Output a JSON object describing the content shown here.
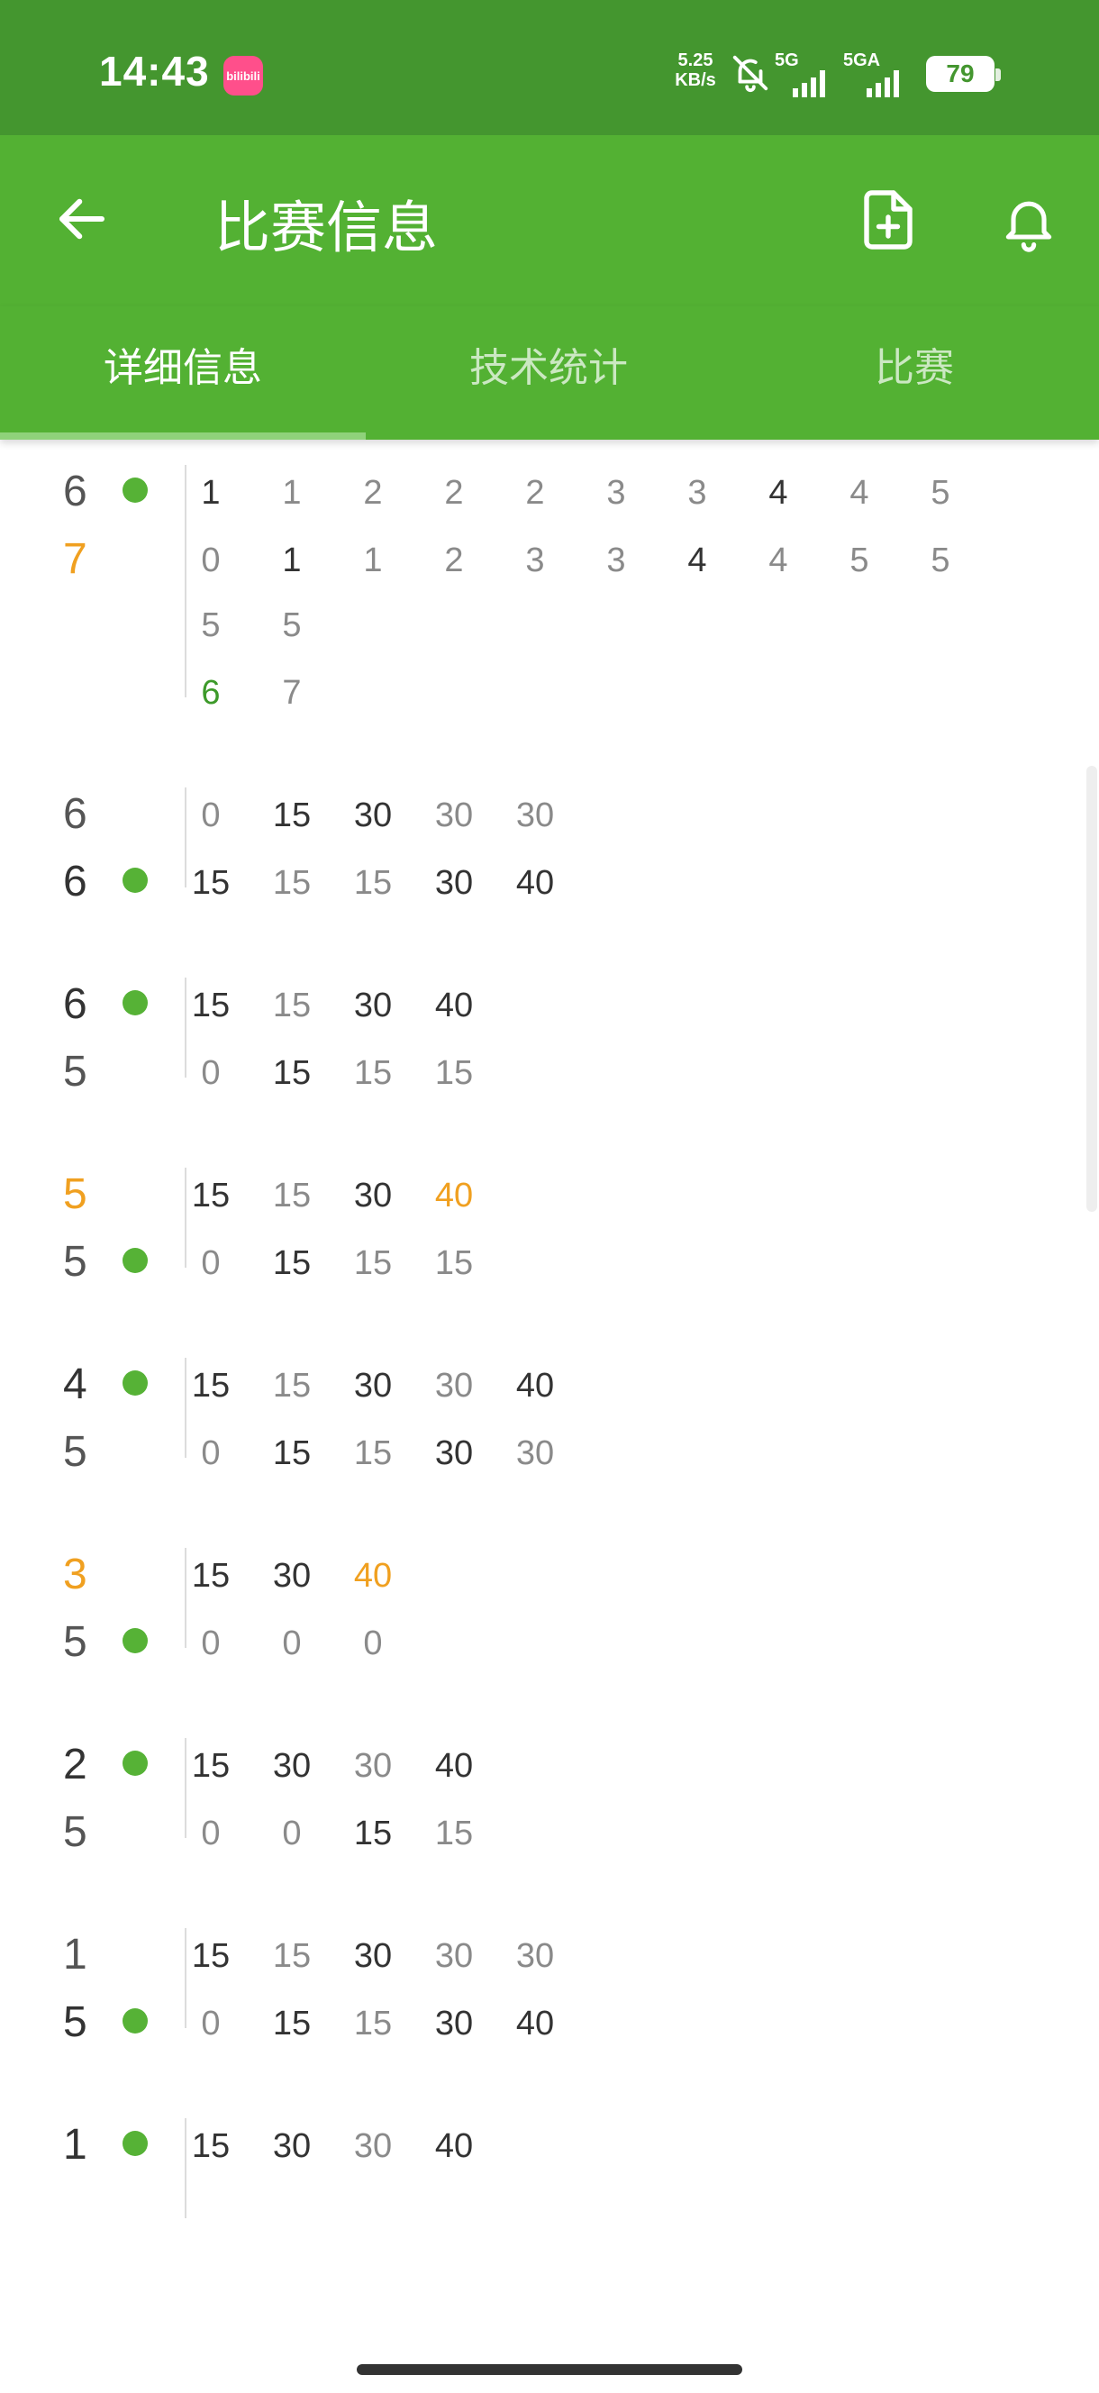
{
  "status_bar": {
    "time": "14:43",
    "app_badge": "bilibili",
    "net_speed_value": "5.25",
    "net_speed_unit": "KB/s",
    "signal1_label": "5G",
    "signal2_label": "5GA",
    "battery": "79"
  },
  "app_bar": {
    "title": "比赛信息"
  },
  "tabs": [
    {
      "label": "详细信息",
      "active": true
    },
    {
      "label": "技术统计",
      "active": false
    },
    {
      "label": "比赛",
      "active": false
    }
  ],
  "colors": {
    "status_bar": "#44962f",
    "primary": "#53b133",
    "serve_dot": "#56b236",
    "highlight": "#f0a020"
  },
  "games": [
    {
      "top_score": "6",
      "bottom_score": "7",
      "top_style": "normal",
      "bottom_style": "win",
      "server": "top",
      "rows": [
        {
          "top": [
            [
              "1",
              "b"
            ],
            [
              "1",
              "n"
            ],
            [
              "2",
              "n"
            ],
            [
              "2",
              "n"
            ],
            [
              "2",
              "n"
            ],
            [
              "3",
              "n"
            ],
            [
              "3",
              "n"
            ],
            [
              "4",
              "b"
            ],
            [
              "4",
              "n"
            ],
            [
              "5",
              "n"
            ]
          ],
          "bottom": [
            [
              "0",
              "n"
            ],
            [
              "1",
              "b"
            ],
            [
              "1",
              "n"
            ],
            [
              "2",
              "n"
            ],
            [
              "3",
              "n"
            ],
            [
              "3",
              "n"
            ],
            [
              "4",
              "b"
            ],
            [
              "4",
              "n"
            ],
            [
              "5",
              "n"
            ],
            [
              "5",
              "n"
            ]
          ]
        },
        {
          "top": [
            [
              "5",
              "n"
            ],
            [
              "5",
              "n"
            ]
          ],
          "bottom": [
            [
              "6",
              "g"
            ],
            [
              "7",
              "n"
            ]
          ]
        }
      ]
    },
    {
      "top_score": "6",
      "bottom_score": "6",
      "top_style": "normal",
      "bottom_style": "dark",
      "server": "bottom",
      "rows": [
        {
          "top": [
            [
              "0",
              "n"
            ],
            [
              "15",
              "b"
            ],
            [
              "30",
              "b"
            ],
            [
              "30",
              "n"
            ],
            [
              "30",
              "n"
            ]
          ],
          "bottom": [
            [
              "15",
              "b"
            ],
            [
              "15",
              "n"
            ],
            [
              "15",
              "n"
            ],
            [
              "30",
              "b"
            ],
            [
              "40",
              "b"
            ]
          ]
        }
      ]
    },
    {
      "top_score": "6",
      "bottom_score": "5",
      "top_style": "dark",
      "bottom_style": "normal",
      "server": "top",
      "rows": [
        {
          "top": [
            [
              "15",
              "b"
            ],
            [
              "15",
              "n"
            ],
            [
              "30",
              "b"
            ],
            [
              "40",
              "b"
            ]
          ],
          "bottom": [
            [
              "0",
              "n"
            ],
            [
              "15",
              "b"
            ],
            [
              "15",
              "n"
            ],
            [
              "15",
              "n"
            ]
          ]
        }
      ]
    },
    {
      "top_score": "5",
      "bottom_score": "5",
      "top_style": "win",
      "bottom_style": "normal",
      "server": "bottom",
      "rows": [
        {
          "top": [
            [
              "15",
              "b"
            ],
            [
              "15",
              "n"
            ],
            [
              "30",
              "b"
            ],
            [
              "40",
              "o"
            ]
          ],
          "bottom": [
            [
              "0",
              "n"
            ],
            [
              "15",
              "b"
            ],
            [
              "15",
              "n"
            ],
            [
              "15",
              "n"
            ]
          ]
        }
      ]
    },
    {
      "top_score": "4",
      "bottom_score": "5",
      "top_style": "dark",
      "bottom_style": "normal",
      "server": "top",
      "rows": [
        {
          "top": [
            [
              "15",
              "b"
            ],
            [
              "15",
              "n"
            ],
            [
              "30",
              "b"
            ],
            [
              "30",
              "n"
            ],
            [
              "40",
              "b"
            ]
          ],
          "bottom": [
            [
              "0",
              "n"
            ],
            [
              "15",
              "b"
            ],
            [
              "15",
              "n"
            ],
            [
              "30",
              "b"
            ],
            [
              "30",
              "n"
            ]
          ]
        }
      ]
    },
    {
      "top_score": "3",
      "bottom_score": "5",
      "top_style": "win",
      "bottom_style": "normal",
      "server": "bottom",
      "rows": [
        {
          "top": [
            [
              "15",
              "b"
            ],
            [
              "30",
              "b"
            ],
            [
              "40",
              "o"
            ]
          ],
          "bottom": [
            [
              "0",
              "n"
            ],
            [
              "0",
              "n"
            ],
            [
              "0",
              "n"
            ]
          ]
        }
      ]
    },
    {
      "top_score": "2",
      "bottom_score": "5",
      "top_style": "dark",
      "bottom_style": "normal",
      "server": "top",
      "rows": [
        {
          "top": [
            [
              "15",
              "b"
            ],
            [
              "30",
              "b"
            ],
            [
              "30",
              "n"
            ],
            [
              "40",
              "b"
            ]
          ],
          "bottom": [
            [
              "0",
              "n"
            ],
            [
              "0",
              "n"
            ],
            [
              "15",
              "b"
            ],
            [
              "15",
              "n"
            ]
          ]
        }
      ]
    },
    {
      "top_score": "1",
      "bottom_score": "5",
      "top_style": "normal",
      "bottom_style": "dark",
      "server": "bottom",
      "rows": [
        {
          "top": [
            [
              "15",
              "b"
            ],
            [
              "15",
              "n"
            ],
            [
              "30",
              "b"
            ],
            [
              "30",
              "n"
            ],
            [
              "30",
              "n"
            ]
          ],
          "bottom": [
            [
              "0",
              "n"
            ],
            [
              "15",
              "b"
            ],
            [
              "15",
              "n"
            ],
            [
              "30",
              "b"
            ],
            [
              "40",
              "b"
            ]
          ]
        }
      ]
    },
    {
      "top_score": "1",
      "bottom_score": "",
      "top_style": "dark",
      "bottom_style": "normal",
      "server": "top",
      "rows": [
        {
          "top": [
            [
              "15",
              "b"
            ],
            [
              "30",
              "b"
            ],
            [
              "30",
              "n"
            ],
            [
              "40",
              "b"
            ]
          ],
          "bottom": []
        }
      ]
    }
  ]
}
